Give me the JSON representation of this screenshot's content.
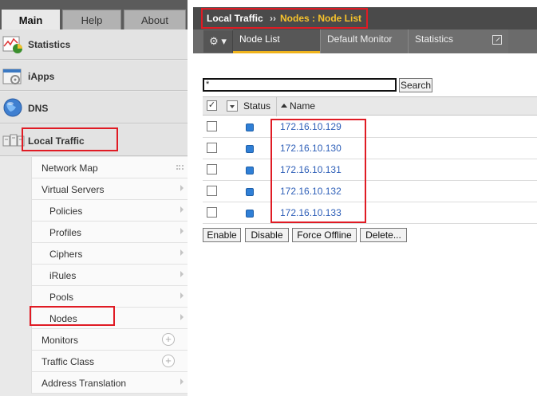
{
  "sidebar": {
    "tabs": [
      {
        "label": "Main",
        "active": true
      },
      {
        "label": "Help",
        "active": false
      },
      {
        "label": "About",
        "active": false
      }
    ],
    "modules": [
      {
        "label": "Statistics",
        "icon": "statistics-chart-icon"
      },
      {
        "label": "iApps",
        "icon": "iapps-gear-icon"
      },
      {
        "label": "DNS",
        "icon": "dns-globe-icon"
      },
      {
        "label": "Local Traffic",
        "icon": "local-traffic-icon"
      }
    ],
    "items": [
      {
        "label": "Network Map",
        "indicator": "grid"
      },
      {
        "label": "Virtual Servers",
        "indicator": "chevron"
      },
      {
        "label": "Policies",
        "indicator": "chevron"
      },
      {
        "label": "Profiles",
        "indicator": "chevron"
      },
      {
        "label": "Ciphers",
        "indicator": "chevron"
      },
      {
        "label": "iRules",
        "indicator": "chevron"
      },
      {
        "label": "Pools",
        "indicator": "chevron"
      },
      {
        "label": "Nodes",
        "indicator": "chevron"
      },
      {
        "label": "Monitors",
        "indicator": "plus"
      },
      {
        "label": "Traffic Class",
        "indicator": "plus"
      },
      {
        "label": "Address Translation",
        "indicator": "chevron"
      }
    ]
  },
  "breadcrumb": {
    "section": "Local Traffic",
    "separator": "››",
    "page": "Nodes : Node List"
  },
  "subtabs": {
    "gear_icon": "gear-icon",
    "node_list": "Node List",
    "default_monitor": "Default Monitor",
    "statistics": "Statistics"
  },
  "search": {
    "value": "*",
    "button": "Search"
  },
  "table": {
    "columns": {
      "status": "Status",
      "name": "Name"
    },
    "rows": [
      {
        "name": "172.16.10.129",
        "status": "available"
      },
      {
        "name": "172.16.10.130",
        "status": "available"
      },
      {
        "name": "172.16.10.131",
        "status": "available"
      },
      {
        "name": "172.16.10.132",
        "status": "available"
      },
      {
        "name": "172.16.10.133",
        "status": "available"
      }
    ]
  },
  "actions": {
    "enable": "Enable",
    "disable": "Disable",
    "force_offline": "Force Offline",
    "delete": "Delete..."
  },
  "colors": {
    "highlight_box": "#e01b24",
    "breadcrumb_accent": "#f6c22c",
    "status_available": "#2f7fd6",
    "link": "#2e5fb8"
  }
}
